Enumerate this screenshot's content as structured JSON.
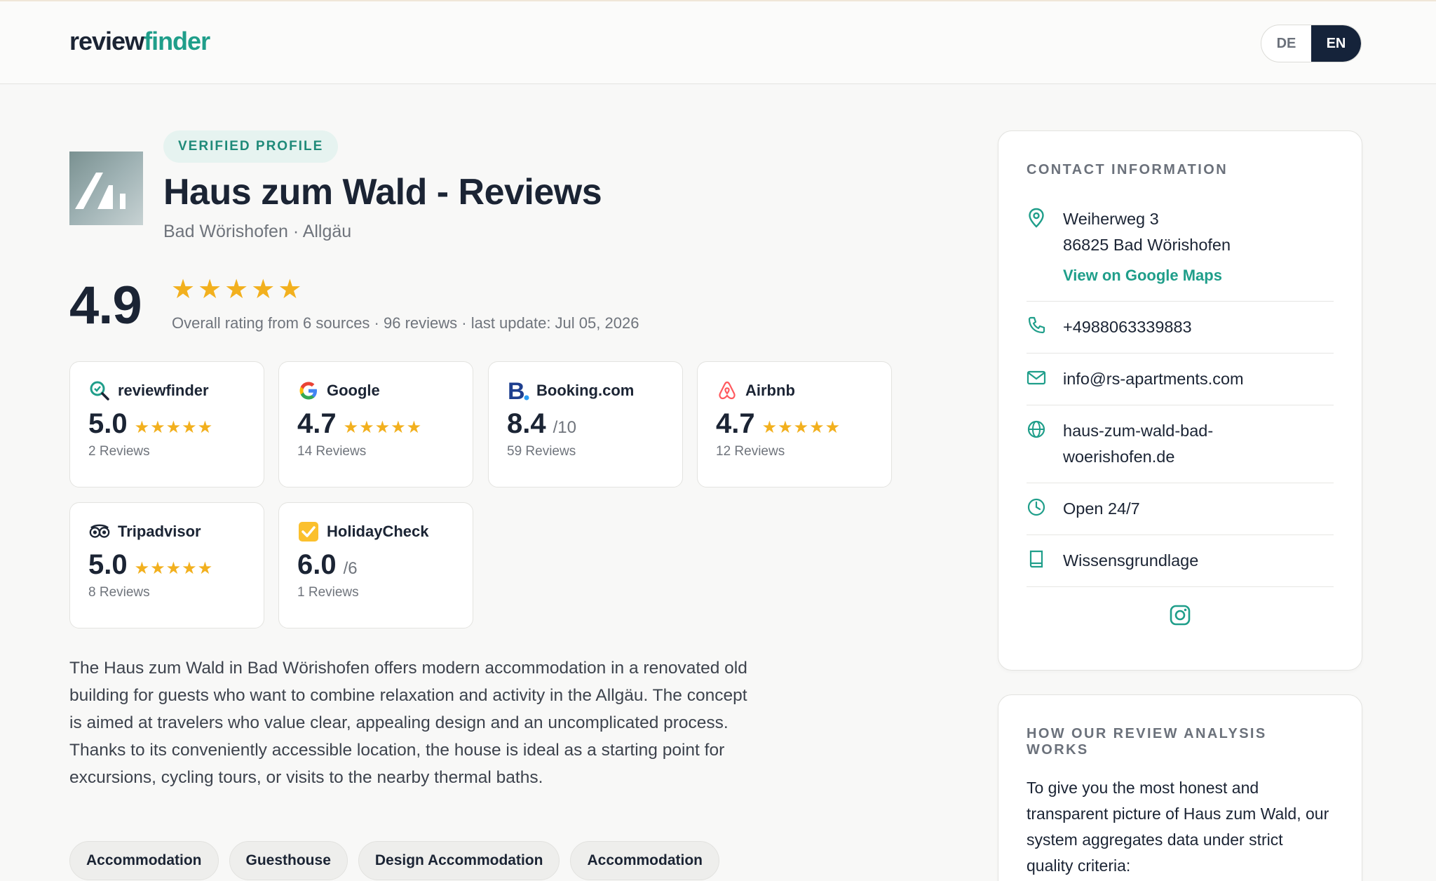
{
  "header": {
    "logo_part1": "review",
    "logo_part2": "finder",
    "languages": [
      {
        "code": "DE",
        "active": false
      },
      {
        "code": "EN",
        "active": true
      }
    ]
  },
  "profile": {
    "badge": "VERIFIED PROFILE",
    "title": "Haus zum Wald - Reviews",
    "location": "Bad Wörishofen · Allgäu",
    "rating": "4.9",
    "stars": "★★★★★",
    "summary": "Overall rating from 6 sources · 96 reviews · last update: Jul 05, 2026"
  },
  "sources": [
    {
      "name": "reviewfinder",
      "score": "5.0",
      "stars": "★★★★★",
      "unit": "",
      "reviews": "2 Reviews",
      "icon": "search-check-icon"
    },
    {
      "name": "Google",
      "score": "4.7",
      "stars": "★★★★★",
      "unit": "",
      "reviews": "14 Reviews",
      "icon": "google-icon"
    },
    {
      "name": "Booking.com",
      "score": "8.4",
      "stars": "",
      "unit": "/10",
      "reviews": "59 Reviews",
      "icon": "booking-icon"
    },
    {
      "name": "Airbnb",
      "score": "4.7",
      "stars": "★★★★★",
      "unit": "",
      "reviews": "12 Reviews",
      "icon": "airbnb-icon"
    },
    {
      "name": "Tripadvisor",
      "score": "5.0",
      "stars": "★★★★★",
      "unit": "",
      "reviews": "8 Reviews",
      "icon": "tripadvisor-icon"
    },
    {
      "name": "HolidayCheck",
      "score": "6.0",
      "stars": "",
      "unit": "/6",
      "reviews": "1 Reviews",
      "icon": "holidaycheck-icon"
    }
  ],
  "description": "The Haus zum Wald in Bad Wörishofen offers modern accommodation in a renovated old building for guests who want to combine relaxation and activity in the Allgäu. The concept is aimed at travelers who value clear, appealing design and an uncomplicated process. Thanks to its conveniently accessible location, the house is ideal as a starting point for excursions, cycling tours, or visits to the nearby thermal baths.",
  "tags": [
    "Accommodation",
    "Guesthouse",
    "Design Accommodation",
    "Accommodation"
  ],
  "contact": {
    "title": "CONTACT INFORMATION",
    "address_line1": "Weiherweg 3",
    "address_line2": "86825 Bad Wörishofen",
    "maps_link": "View on Google Maps",
    "phone": "+4988063339883",
    "email": "info@rs-apartments.com",
    "website_line1": "haus-zum-wald-bad-",
    "website_line2": "woerishofen.de",
    "hours": "Open 24/7",
    "knowledge": "Wissensgrundlage"
  },
  "how": {
    "title": "HOW OUR REVIEW ANALYSIS WORKS",
    "text": "To give you the most honest and transparent picture of Haus zum Wald, our system aggregates data under strict quality criteria:"
  },
  "colors": {
    "accent": "#1f9e8a",
    "star": "#f2b01e",
    "navy": "#15233a"
  }
}
